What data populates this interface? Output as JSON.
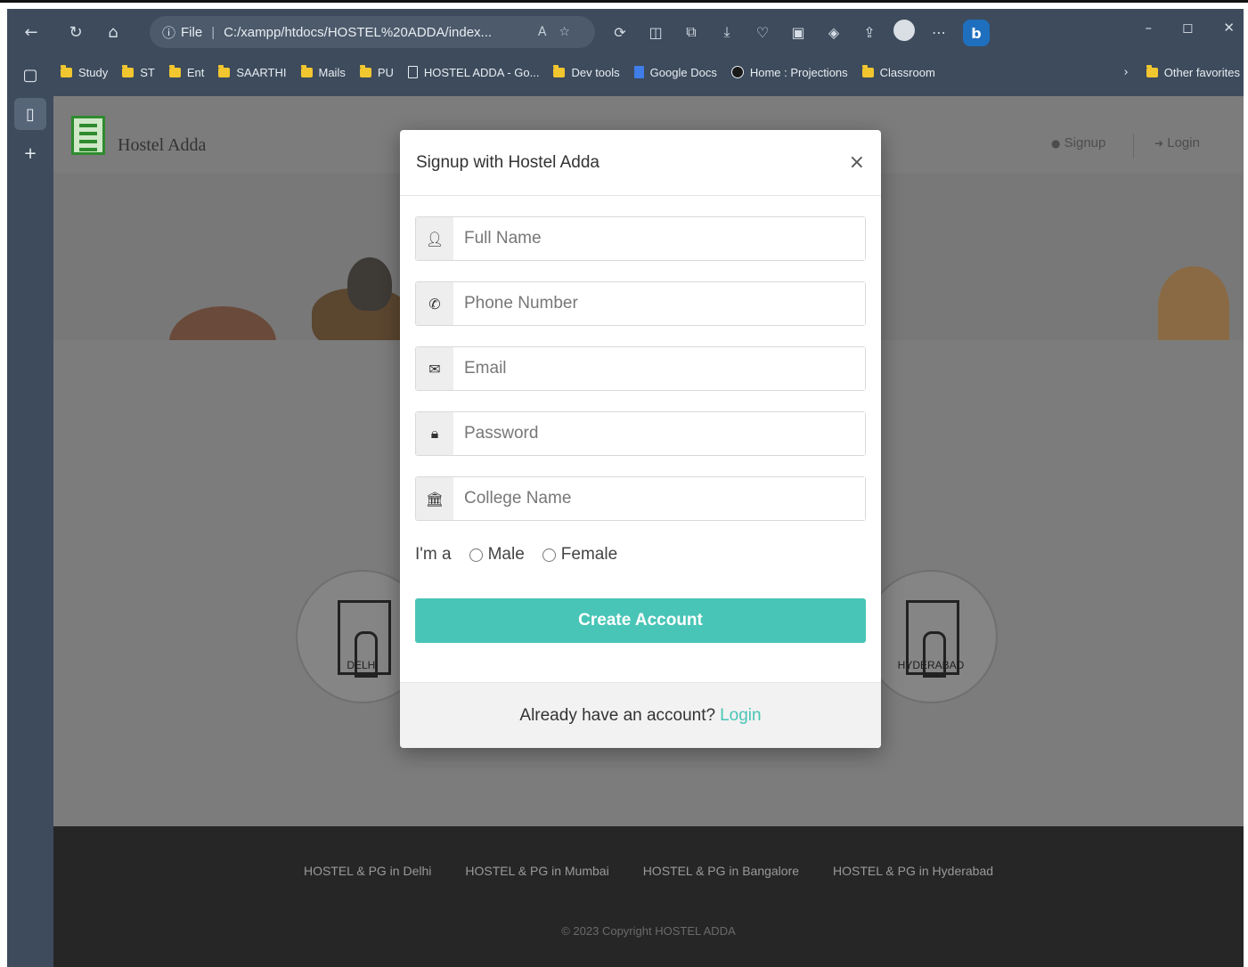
{
  "browser": {
    "address": {
      "scheme_label": "File",
      "url": "C:/xampp/htdocs/HOSTEL%20ADDA/index..."
    },
    "favorites": [
      {
        "label": "Study",
        "type": "folder"
      },
      {
        "label": "ST",
        "type": "folder"
      },
      {
        "label": "Ent",
        "type": "folder"
      },
      {
        "label": "SAARTHI",
        "type": "folder"
      },
      {
        "label": "Mails",
        "type": "folder"
      },
      {
        "label": "PU",
        "type": "folder"
      },
      {
        "label": "HOSTEL ADDA - Go...",
        "type": "page"
      },
      {
        "label": "Dev tools",
        "type": "folder"
      },
      {
        "label": "Google Docs",
        "type": "gdoc"
      },
      {
        "label": "Home : Projections",
        "type": "site"
      },
      {
        "label": "Classroom",
        "type": "folder"
      }
    ],
    "other_favorites": "Other favorites"
  },
  "site": {
    "brand": "Hostel Adda",
    "nav": {
      "signup": "Signup",
      "login": "Login"
    },
    "cities": [
      "DELHI",
      "HYDERABAD"
    ],
    "footer_links": [
      "HOSTEL & PG in Delhi",
      "HOSTEL & PG in Mumbai",
      "HOSTEL & PG in Bangalore",
      "HOSTEL & PG in Hyderabad"
    ],
    "copyright": "© 2023 Copyright HOSTEL ADDA"
  },
  "modal": {
    "title": "Signup with Hostel Adda",
    "close": "×",
    "fields": {
      "full_name": {
        "placeholder": "Full Name",
        "icon": "user-icon"
      },
      "phone": {
        "placeholder": "Phone Number",
        "icon": "phone-icon"
      },
      "email": {
        "placeholder": "Email",
        "icon": "envelope-icon"
      },
      "password": {
        "placeholder": "Password",
        "icon": "lock-icon"
      },
      "college": {
        "placeholder": "College Name",
        "icon": "institution-icon"
      }
    },
    "gender": {
      "prompt": "I'm a",
      "male": "Male",
      "female": "Female"
    },
    "submit": "Create Account",
    "footer_text": "Already have an account?",
    "footer_link": "Login"
  },
  "colors": {
    "accent": "#48c5b6",
    "browser_chrome": "#3d4b5c",
    "footer": "#262626"
  }
}
